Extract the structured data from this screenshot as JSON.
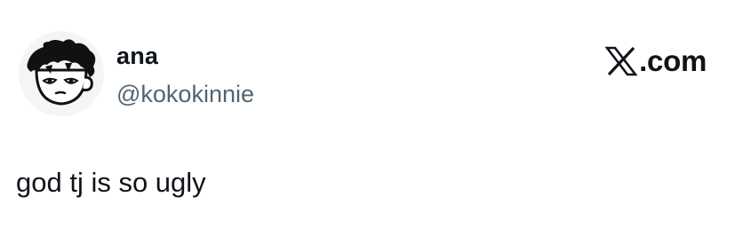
{
  "tweet": {
    "author": {
      "display_name": "ana",
      "handle": "@kokokinnie",
      "avatar_icon": "cartoon-boy-avatar"
    },
    "brand": {
      "icon": "x-logo-icon",
      "label": ".com"
    },
    "text": "god tj is so ugly"
  },
  "colors": {
    "background": "#ffffff",
    "primary_text": "#0f1419",
    "secondary_text": "#536471"
  }
}
